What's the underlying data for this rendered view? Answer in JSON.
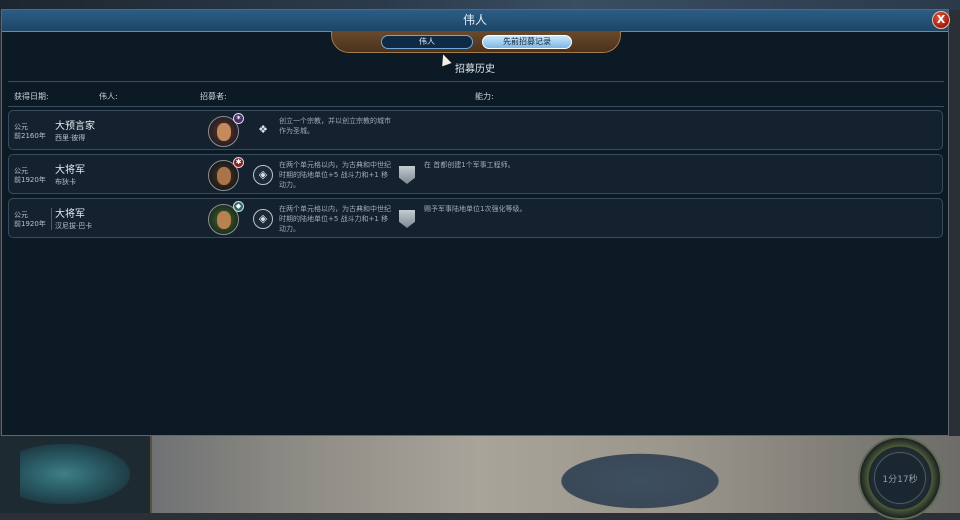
{
  "window": {
    "title": "伟人",
    "close_label": "X"
  },
  "tabs": [
    {
      "label": "伟人"
    },
    {
      "label": "先前招募记录"
    }
  ],
  "section_title": "招募历史",
  "columns": {
    "date": "获得日期:",
    "great_person": "伟人:",
    "recruiter": "招募者:",
    "ability": "能力:"
  },
  "rows": [
    {
      "era": "公元",
      "year": "前2160年",
      "type": "大预言家",
      "person": "西里·彼得",
      "recruiter_icon": "leader-portrait-religious",
      "badge": "✶",
      "ability_icon": "prophet-icon",
      "ability_text": "创立一个宗教，并以创立宗教的城市作为圣城。"
    },
    {
      "era": "公元",
      "year": "前1920年",
      "type": "大将军",
      "person": "布狄卡",
      "recruiter_icon": "leader-portrait-military",
      "badge": "✱",
      "ability_icon": "general-icon",
      "ability_text": "在两个单元格以内，为古典和中世纪时期的陆地单位+5 战斗力和+1 移动力。",
      "extra_icon": "shield-icon",
      "extra_text": "在 首都创建1个军事工程师。"
    },
    {
      "era": "公元",
      "year": "前1920年",
      "type": "大将军",
      "person": "汉尼拔·巴卡",
      "recruiter_icon": "leader-portrait-tribal",
      "badge": "◆",
      "ability_icon": "general-icon",
      "ability_text": "在两个单元格以内，为古典和中世纪时期的陆地单位+5 战斗力和+1 移动力。",
      "extra_icon": "shield-icon",
      "extra_text": "赐予军事陆地单位1次强化等级。"
    }
  ],
  "turn_timer": "1分17秒",
  "colors": {
    "panel_bg": "#0c1a26",
    "title_bar": "#1d4566",
    "tab_frame": "#6a4a2c",
    "active_tab": "#7fb6e3"
  }
}
